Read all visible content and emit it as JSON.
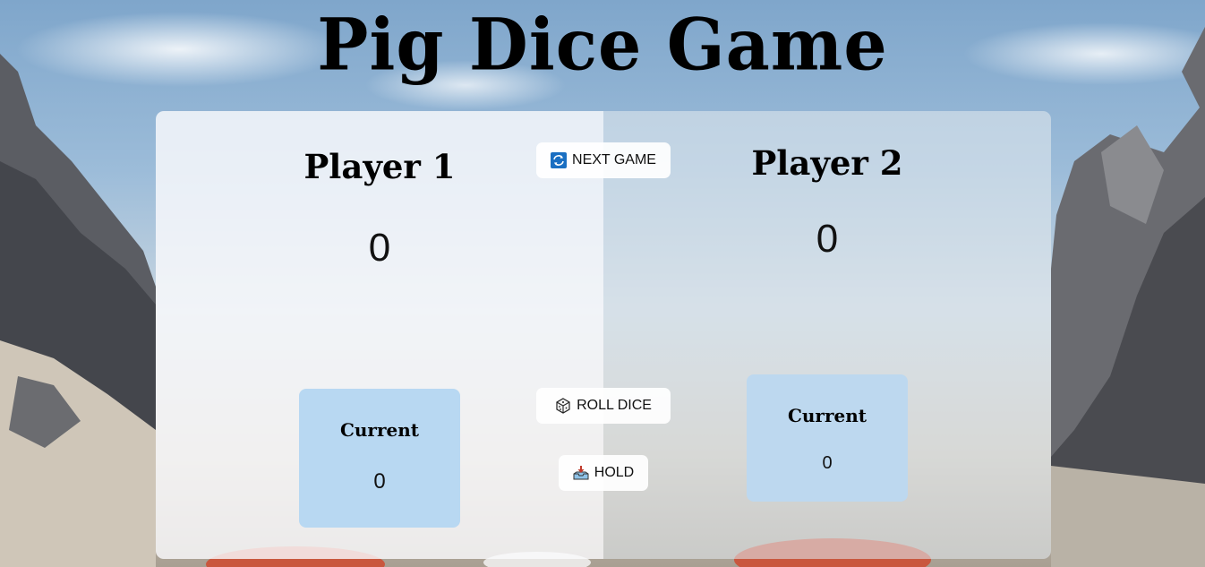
{
  "title": "Pig Dice Game",
  "players": [
    {
      "name": "Player 1",
      "score": "0",
      "current_label": "Current",
      "current_value": "0"
    },
    {
      "name": "Player 2",
      "score": "0",
      "current_label": "Current",
      "current_value": "0"
    }
  ],
  "buttons": {
    "new_game": {
      "label": "NEXT GAME",
      "icon": "repeat-icon"
    },
    "roll_dice": {
      "label": "ROLL DICE",
      "icon": "dice-icon"
    },
    "hold": {
      "label": "HOLD",
      "icon": "inbox-tray-icon"
    }
  },
  "colors": {
    "current_box": "#b8d8f2",
    "repeat_icon": "#1a6fc2"
  }
}
